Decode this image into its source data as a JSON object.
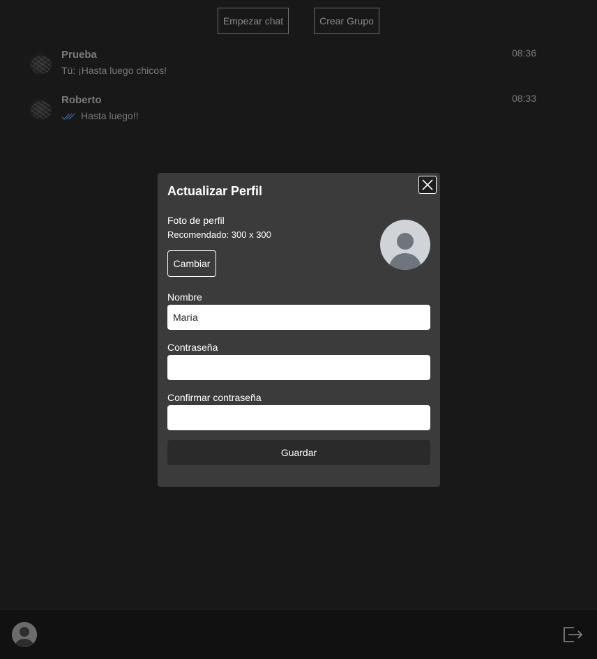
{
  "top_actions": {
    "start_chat": "Empezar chat",
    "create_group": "Crear Grupo"
  },
  "chats": [
    {
      "name": "Prueba",
      "preview": "Tú: ¡Hasta luego chicos!",
      "time": "08:36",
      "read_ticks": false
    },
    {
      "name": "Roberto",
      "preview": "Hasta luego!!",
      "time": "08:33",
      "read_ticks": true
    }
  ],
  "modal": {
    "title": "Actualizar Perfil",
    "photo_label": "Foto de perfil",
    "photo_hint": "Recomendado: 300 x 300",
    "change_label": "Cambiar",
    "name_label": "Nombre",
    "name_value": "María",
    "password_label": "Contraseña",
    "password_value": "",
    "confirm_label": "Confirmar contraseña",
    "confirm_value": "",
    "save_label": "Guardar"
  },
  "icons": {
    "close": "close-icon",
    "avatar": "user-avatar-icon",
    "logout": "logout-icon",
    "ticks": "double-check-icon"
  },
  "colors": {
    "background": "#181818",
    "modal": "#3b3b3b",
    "tick": "#3d5a8a"
  }
}
